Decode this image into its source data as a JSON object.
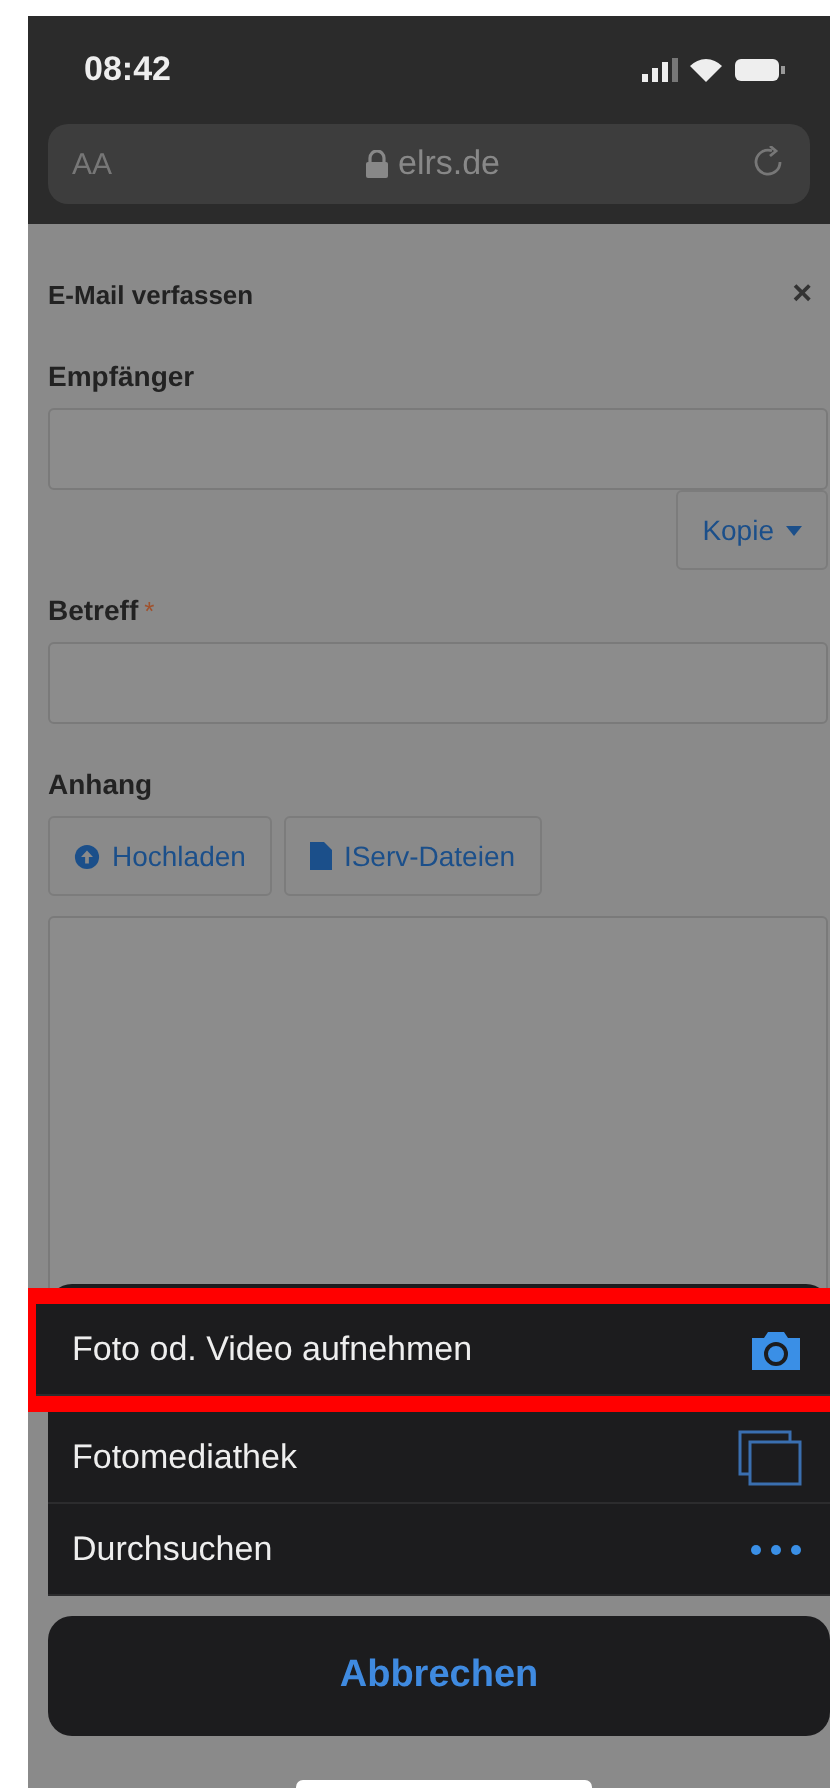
{
  "status_bar": {
    "time": "08:42"
  },
  "browser": {
    "text_size": "AA",
    "url": "elrs.de"
  },
  "dialog": {
    "title": "E-Mail verfassen",
    "close": "×",
    "recipient": {
      "label": "Empfänger"
    },
    "copy_button": {
      "label": "Kopie"
    },
    "subject": {
      "label": "Betreff",
      "required_mark": "*"
    },
    "attachment": {
      "label": "Anhang",
      "buttons": [
        {
          "kind": "upload",
          "label": "Hochladen"
        },
        {
          "kind": "files",
          "label": "IServ-Dateien"
        }
      ]
    }
  },
  "action_sheet": {
    "items": [
      {
        "kind": "camera",
        "label": "Foto od. Video aufnehmen",
        "highlighted": true
      },
      {
        "kind": "library",
        "label": "Fotomediathek",
        "highlighted": false
      },
      {
        "kind": "browse",
        "label": "Durchsuchen",
        "highlighted": false
      }
    ],
    "cancel": "Abbrechen"
  }
}
